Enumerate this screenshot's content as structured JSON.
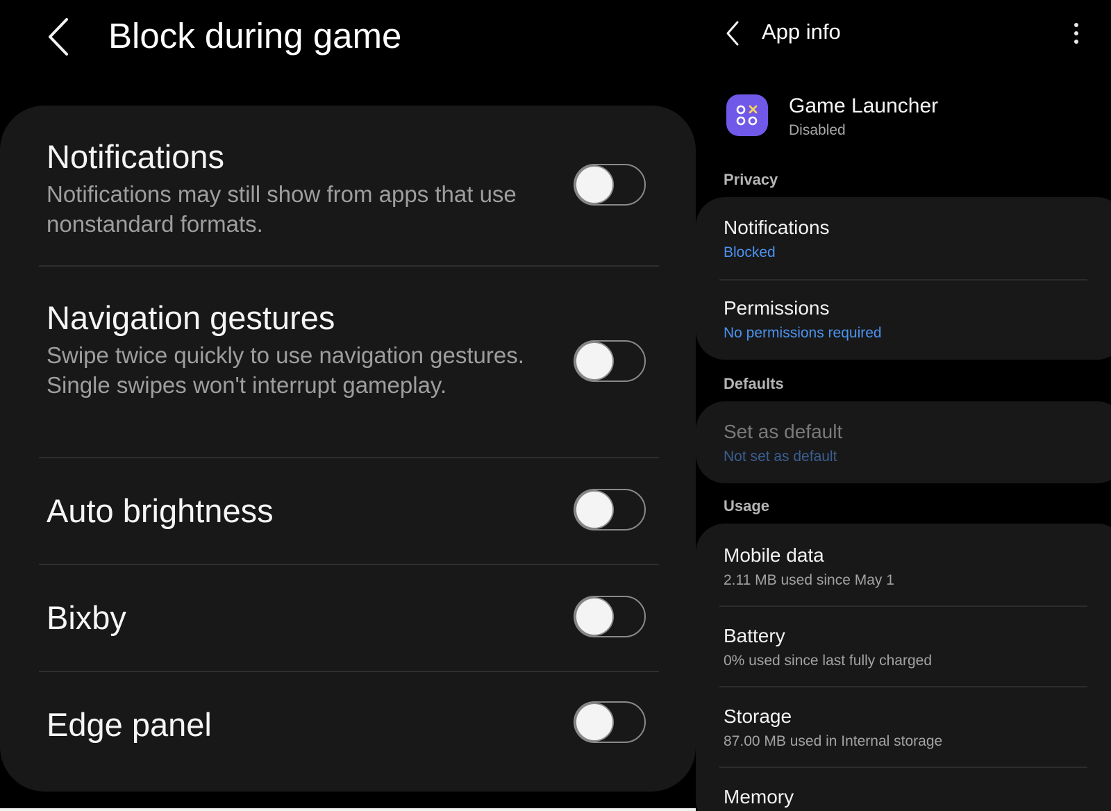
{
  "left": {
    "title": "Block during game",
    "items": [
      {
        "title": "Notifications",
        "description": "Notifications may still show from apps that use nonstandard formats.",
        "enabled": false
      },
      {
        "title": "Navigation gestures",
        "description": "Swipe twice quickly to use navigation gestures. Single swipes won't interrupt gameplay.",
        "enabled": false
      },
      {
        "title": "Auto brightness",
        "description": "",
        "enabled": false
      },
      {
        "title": "Bixby",
        "description": "",
        "enabled": false
      },
      {
        "title": "Edge panel",
        "description": "",
        "enabled": false
      }
    ]
  },
  "right": {
    "title": "App info",
    "app": {
      "name": "Game Launcher",
      "status": "Disabled"
    },
    "sections": {
      "privacy": "Privacy",
      "defaults": "Defaults",
      "usage": "Usage"
    },
    "notifications": {
      "title": "Notifications",
      "value": "Blocked"
    },
    "permissions": {
      "title": "Permissions",
      "value": "No permissions required"
    },
    "set_default": {
      "title": "Set as default",
      "value": "Not set as default"
    },
    "mobile_data": {
      "title": "Mobile data",
      "value": "2.11 MB used since May 1"
    },
    "battery": {
      "title": "Battery",
      "value": "0% used since last fully charged"
    },
    "storage": {
      "title": "Storage",
      "value": "87.00 MB used in Internal storage"
    },
    "memory": {
      "title": "Memory"
    }
  },
  "colors": {
    "background": "#000000",
    "card": "#181818",
    "accent_blue": "#4b93f1",
    "app_icon": "#7058e8",
    "icon_x": "#f3d35a"
  },
  "icons": {
    "back": "chevron-left-icon",
    "more": "more-vertical-icon",
    "app": "game-launcher-icon"
  }
}
